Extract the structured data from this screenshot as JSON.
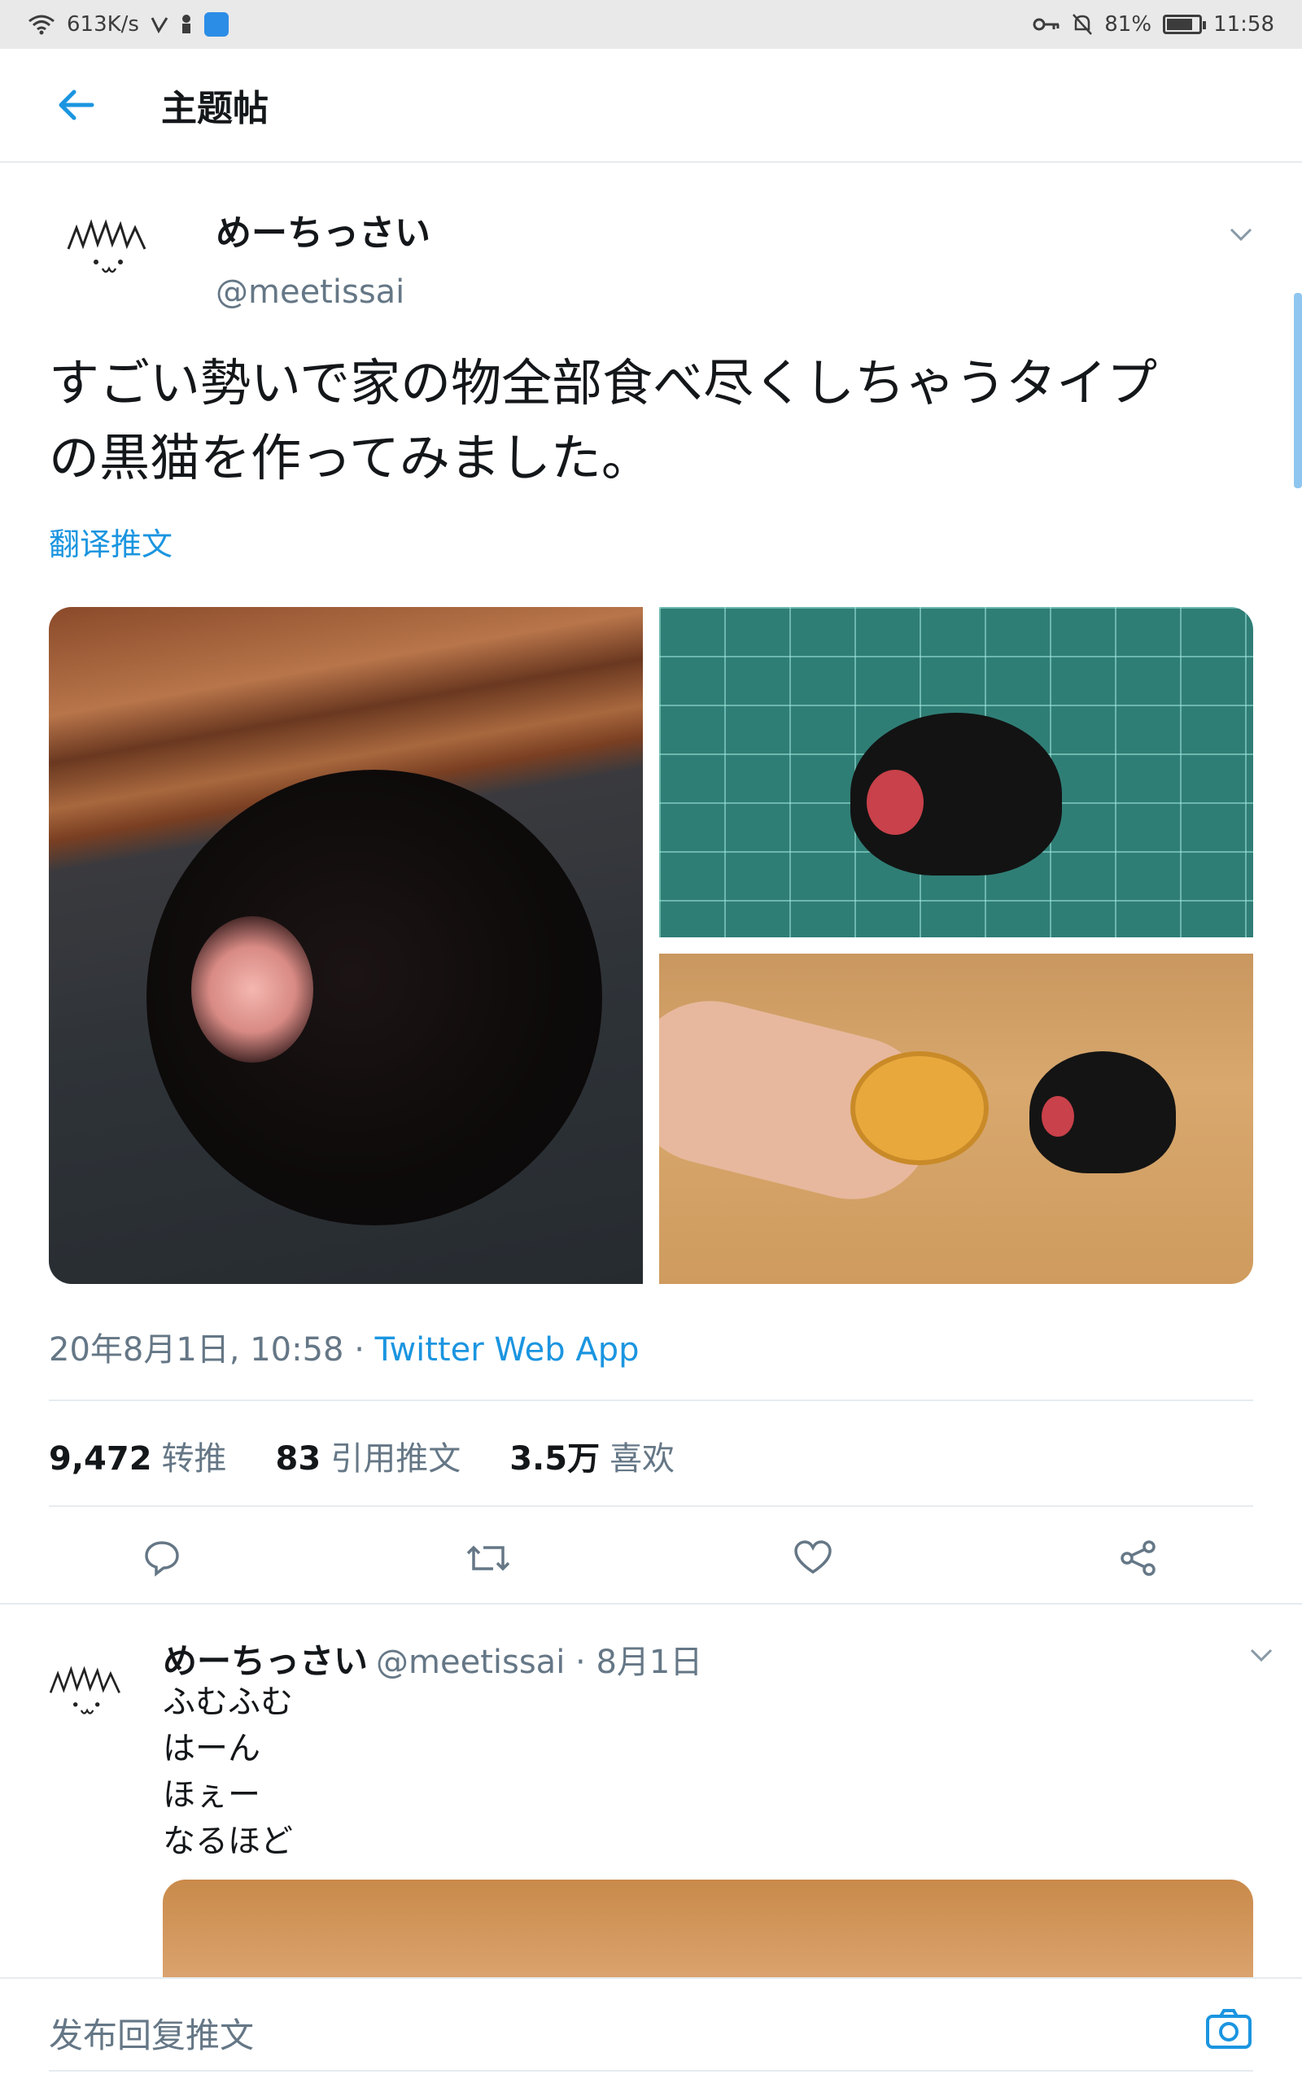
{
  "status_bar": {
    "speed": "613K/s",
    "battery_percent": "81%",
    "battery_level": 0.81,
    "time": "11:58"
  },
  "header": {
    "title": "主题帖"
  },
  "tweet": {
    "display_name": "めーちっさい",
    "handle": "@meetissai",
    "text_line1": "すごい勢いで家の物全部食べ尽くしちゃうタイプ",
    "text_line2": "の黒猫を作ってみました。",
    "translate_label": "翻译推文",
    "timestamp": "20年8月1日, 10:58 · ",
    "source": "Twitter Web App",
    "stats": {
      "retweets_count": "9,472",
      "retweets_label": "转推",
      "quotes_count": "83",
      "quotes_label": "引用推文",
      "likes_count": "3.5万",
      "likes_label": "喜欢"
    }
  },
  "reply": {
    "display_name": "めーちっさい",
    "handle_date": "@meetissai · 8月1日",
    "lines": [
      "ふむふむ",
      "はーん",
      "ほぇー",
      "なるほど"
    ]
  },
  "compose": {
    "placeholder": "发布回复推文"
  },
  "colors": {
    "accent": "#1b95e0",
    "secondary_text": "#657786",
    "divider": "#e6ecf0"
  },
  "icons": [
    "wifi-icon",
    "signal-icon",
    "app-notification-icon",
    "key-icon",
    "mute-icon",
    "battery-icon",
    "back-arrow-icon",
    "chevron-down-icon",
    "reply-icon",
    "retweet-icon",
    "like-icon",
    "share-icon",
    "camera-icon"
  ]
}
